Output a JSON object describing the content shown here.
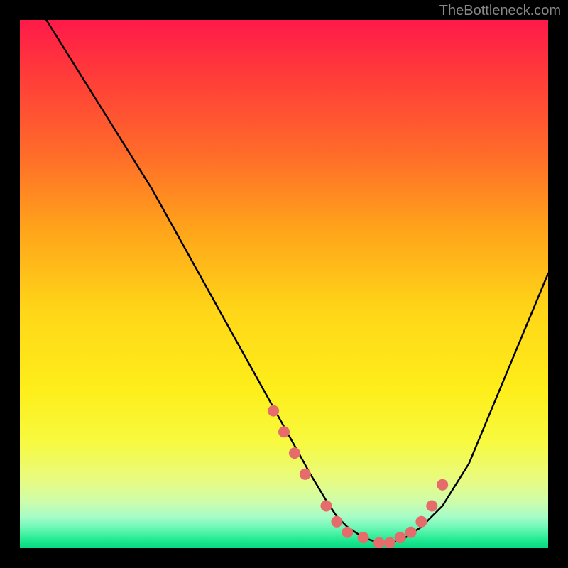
{
  "attribution": "TheBottleneck.com",
  "chart_data": {
    "type": "line",
    "title": "",
    "xlabel": "",
    "ylabel": "",
    "xlim": [
      0,
      100
    ],
    "ylim": [
      0,
      100
    ],
    "series": [
      {
        "name": "bottleneck-curve",
        "x": [
          5,
          10,
          15,
          20,
          25,
          30,
          35,
          40,
          45,
          50,
          55,
          58,
          60,
          62,
          65,
          68,
          70,
          73,
          76,
          80,
          85,
          90,
          95,
          100
        ],
        "y": [
          100,
          92,
          84,
          76,
          68,
          59,
          50,
          41,
          32,
          23,
          14,
          9,
          6,
          4,
          2,
          1,
          1,
          2,
          4,
          8,
          16,
          28,
          40,
          52
        ]
      }
    ],
    "markers": {
      "name": "curve-points",
      "x": [
        48,
        50,
        52,
        54,
        58,
        60,
        62,
        65,
        68,
        70,
        72,
        74,
        76,
        78,
        80
      ],
      "y": [
        26,
        22,
        18,
        14,
        8,
        5,
        3,
        2,
        1,
        1,
        2,
        3,
        5,
        8,
        12
      ]
    },
    "gradient_stops": [
      {
        "pos": 0.0,
        "color": "#ff1a4a"
      },
      {
        "pos": 0.1,
        "color": "#ff3a3a"
      },
      {
        "pos": 0.25,
        "color": "#ff6a2a"
      },
      {
        "pos": 0.4,
        "color": "#ffa51a"
      },
      {
        "pos": 0.55,
        "color": "#ffd618"
      },
      {
        "pos": 0.7,
        "color": "#feee1a"
      },
      {
        "pos": 0.8,
        "color": "#f7fa40"
      },
      {
        "pos": 0.87,
        "color": "#e8fb80"
      },
      {
        "pos": 0.91,
        "color": "#d0fca8"
      },
      {
        "pos": 0.94,
        "color": "#a8fcc8"
      },
      {
        "pos": 0.96,
        "color": "#70f8b8"
      },
      {
        "pos": 0.975,
        "color": "#40f0a0"
      },
      {
        "pos": 0.985,
        "color": "#20e890"
      },
      {
        "pos": 0.993,
        "color": "#10e088"
      },
      {
        "pos": 1.0,
        "color": "#0ad884"
      }
    ],
    "marker_color": "#e66b6b",
    "curve_color": "#000000"
  }
}
